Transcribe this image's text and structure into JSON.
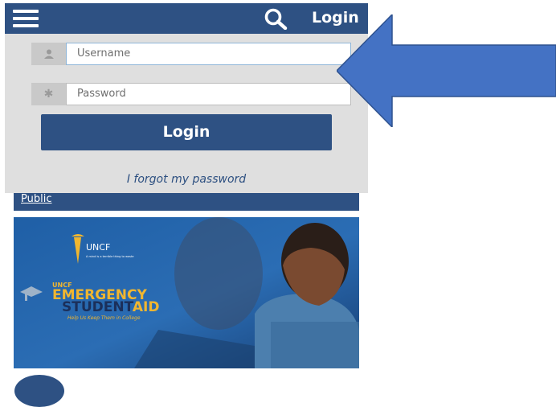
{
  "header": {
    "login_label": "Login"
  },
  "login_form": {
    "username_placeholder": "Username",
    "password_placeholder": "Password",
    "login_button": "Login",
    "forgot_link": "I forgot my password"
  },
  "public_link": "Public",
  "banner": {
    "uncf_logo_text": "UNCF",
    "uncf_motto": "A mind is a terrible thing to waste",
    "headline_prefix": "UNCF",
    "headline_line1": "EMERGENCY",
    "headline_line2_part1": "STUDENT",
    "headline_line2_part2": "AID",
    "tagline": "Help Us Keep Them in College"
  },
  "colors": {
    "brand_blue": "#2e5183",
    "arrow_blue": "#4472c4",
    "panel_gray": "#dfdfdf",
    "headline_gold": "#f0b630"
  },
  "icons": [
    "menu-icon",
    "search-icon",
    "user-icon",
    "key-icon",
    "callout-arrow"
  ]
}
